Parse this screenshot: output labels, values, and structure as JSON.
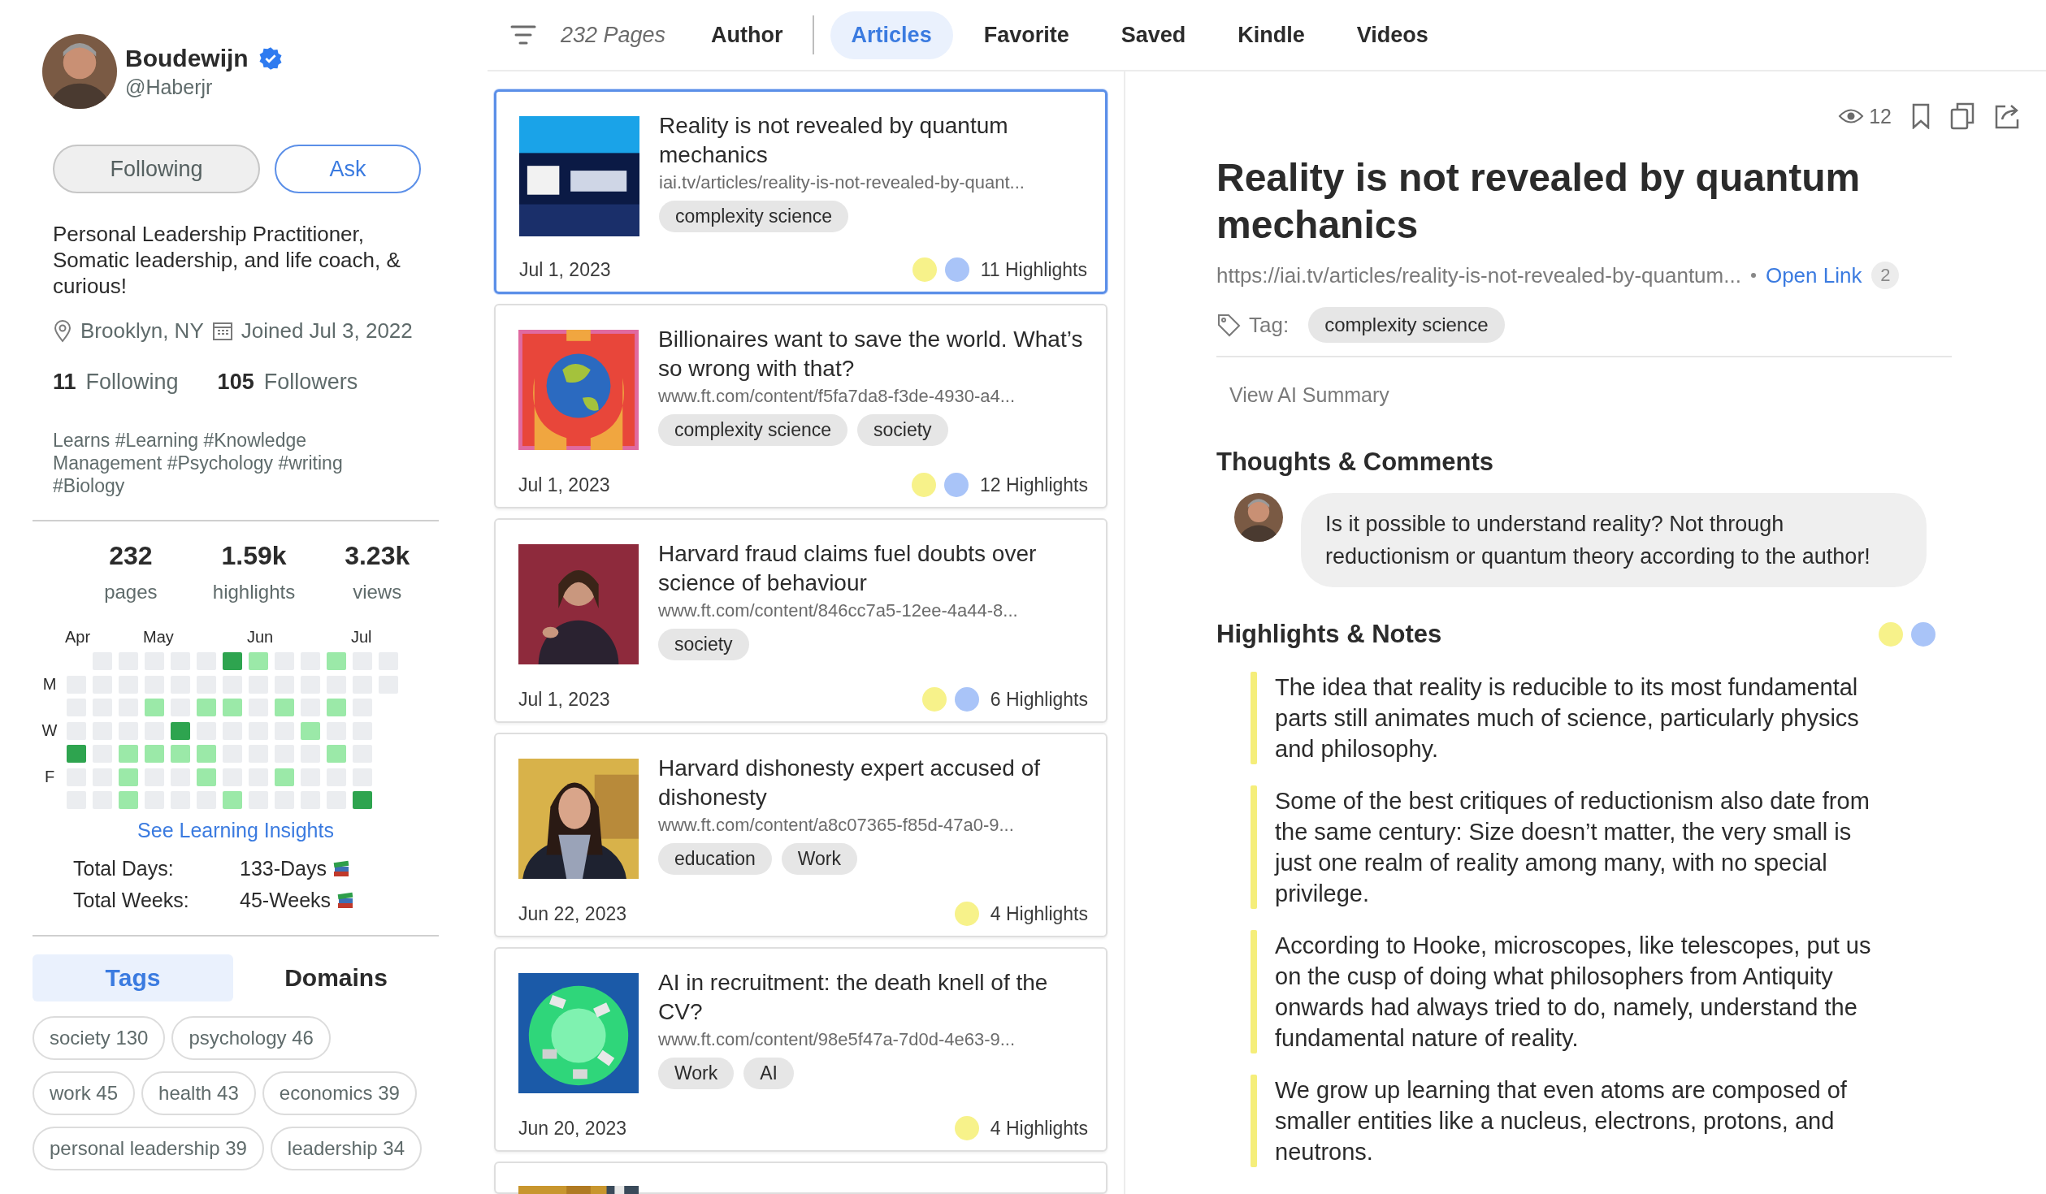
{
  "profile": {
    "name": "Boudewijn",
    "verified": true,
    "handle": "@Haberjr",
    "buttons": [
      {
        "label": "Following",
        "kind": "secondary"
      },
      {
        "label": "Ask",
        "kind": "outline"
      }
    ],
    "bio": "Personal Leadership Practitioner, Somatic leadership, and life coach, & curious!",
    "location": "Brooklyn, NY",
    "joined": "Joined Jul 3, 2022",
    "following_count": "11",
    "following_label": "Following",
    "followers_count": "105",
    "followers_label": "Followers",
    "interests": "Learns #Learning #Knowledge Management #Psychology #writing #Biology",
    "stats": [
      {
        "value": "232",
        "label": "pages"
      },
      {
        "value": "1.59k",
        "label": "highlights"
      },
      {
        "value": "3.23k",
        "label": "views"
      }
    ]
  },
  "activity": {
    "months": [
      "Apr",
      "May",
      "Jun",
      "Jul"
    ],
    "rows": [
      {
        "cells": [
          null,
          {
            "kind": "empty"
          },
          {
            "kind": "empty"
          },
          {
            "kind": "empty"
          },
          {
            "kind": "empty"
          },
          {
            "kind": "empty"
          },
          {
            "kind": "dark"
          },
          {
            "kind": "light"
          },
          {
            "kind": "empty"
          },
          {
            "kind": "empty"
          },
          {
            "kind": "light"
          },
          {
            "kind": "empty"
          },
          {
            "kind": "empty"
          }
        ]
      },
      {
        "label": "M",
        "cells": [
          {
            "kind": "empty"
          },
          {
            "kind": "empty"
          },
          {
            "kind": "empty"
          },
          {
            "kind": "empty"
          },
          {
            "kind": "empty"
          },
          {
            "kind": "empty"
          },
          {
            "kind": "empty"
          },
          {
            "kind": "empty"
          },
          {
            "kind": "empty"
          },
          {
            "kind": "empty"
          },
          {
            "kind": "empty"
          },
          {
            "kind": "empty"
          },
          {
            "kind": "empty"
          }
        ]
      },
      {
        "cells": [
          {
            "kind": "empty"
          },
          {
            "kind": "empty"
          },
          {
            "kind": "empty"
          },
          {
            "kind": "light"
          },
          {
            "kind": "empty"
          },
          {
            "kind": "light"
          },
          {
            "kind": "light"
          },
          {
            "kind": "empty"
          },
          {
            "kind": "light"
          },
          {
            "kind": "empty"
          },
          {
            "kind": "light"
          },
          {
            "kind": "empty"
          }
        ]
      },
      {
        "label": "W",
        "cells": [
          {
            "kind": "empty"
          },
          {
            "kind": "empty"
          },
          {
            "kind": "empty"
          },
          {
            "kind": "empty"
          },
          {
            "kind": "dark"
          },
          {
            "kind": "empty"
          },
          {
            "kind": "empty"
          },
          {
            "kind": "empty"
          },
          {
            "kind": "empty"
          },
          {
            "kind": "light"
          },
          {
            "kind": "empty"
          },
          {
            "kind": "empty"
          }
        ]
      },
      {
        "cells": [
          {
            "kind": "dark"
          },
          {
            "kind": "empty"
          },
          {
            "kind": "light"
          },
          {
            "kind": "light"
          },
          {
            "kind": "light"
          },
          {
            "kind": "light"
          },
          {
            "kind": "empty"
          },
          {
            "kind": "empty"
          },
          {
            "kind": "empty"
          },
          {
            "kind": "empty"
          },
          {
            "kind": "light"
          },
          {
            "kind": "empty"
          }
        ]
      },
      {
        "label": "F",
        "cells": [
          {
            "kind": "empty"
          },
          {
            "kind": "empty"
          },
          {
            "kind": "light"
          },
          {
            "kind": "empty"
          },
          {
            "kind": "empty"
          },
          {
            "kind": "light"
          },
          {
            "kind": "empty"
          },
          {
            "kind": "empty"
          },
          {
            "kind": "light"
          },
          {
            "kind": "empty"
          },
          {
            "kind": "empty"
          },
          {
            "kind": "empty"
          }
        ]
      },
      {
        "cells": [
          {
            "kind": "empty"
          },
          {
            "kind": "empty"
          },
          {
            "kind": "light"
          },
          {
            "kind": "empty"
          },
          {
            "kind": "empty"
          },
          {
            "kind": "empty"
          },
          {
            "kind": "light"
          },
          {
            "kind": "empty"
          },
          {
            "kind": "empty"
          },
          {
            "kind": "empty"
          },
          {
            "kind": "empty"
          },
          {
            "kind": "dark"
          }
        ]
      }
    ],
    "link": "See Learning Insights",
    "totals": [
      {
        "label": "Total Days:",
        "value": "133-Days"
      },
      {
        "label": "Total Weeks:",
        "value": "45-Weeks"
      }
    ]
  },
  "sidebar_tabs": [
    {
      "label": "Tags",
      "selected": true
    },
    {
      "label": "Domains",
      "selected": false
    }
  ],
  "tag_counts": [
    {
      "name": "society",
      "count": "130"
    },
    {
      "name": "psychology",
      "count": "46"
    },
    {
      "name": "work",
      "count": "45"
    },
    {
      "name": "health",
      "count": "43"
    },
    {
      "name": "economics",
      "count": "39"
    },
    {
      "name": "personal leadership",
      "count": "39"
    },
    {
      "name": "leadership",
      "count": "34"
    }
  ],
  "toolbar": {
    "page_count": "232 Pages",
    "tabs": [
      {
        "label": "Author",
        "selected": false
      },
      {
        "label": "Articles",
        "selected": true
      },
      {
        "label": "Favorite",
        "selected": false
      },
      {
        "label": "Saved",
        "selected": false
      },
      {
        "label": "Kindle",
        "selected": false
      },
      {
        "label": "Videos",
        "selected": false
      }
    ]
  },
  "articles": [
    {
      "kind": "full",
      "selected": true,
      "title": "Reality is not revealed by quantum mechanics",
      "url": "iai.tv/articles/reality-is-not-revealed-by-quant...",
      "tags": [
        "complexity science"
      ],
      "date": "Jul 1, 2023",
      "dots": [
        {
          "color": "#f7f28a"
        },
        {
          "color": "#a9c4f8"
        }
      ],
      "highlights": "11 Highlights"
    },
    {
      "kind": "full",
      "selected": false,
      "title": "Billionaires want to save the world. What’s so wrong with that?",
      "url": "www.ft.com/content/f5fa7da8-f3de-4930-a4...",
      "tags": [
        "complexity science",
        "society"
      ],
      "date": "Jul 1, 2023",
      "dots": [
        {
          "color": "#f7f28a"
        },
        {
          "color": "#a9c4f8"
        }
      ],
      "highlights": "12 Highlights"
    },
    {
      "kind": "full",
      "selected": false,
      "title": "Harvard fraud claims fuel doubts over science of behaviour",
      "url": "www.ft.com/content/846cc7a5-12ee-4a44-8...",
      "tags": [
        "society"
      ],
      "date": "Jul 1, 2023",
      "dots": [
        {
          "color": "#f7f28a"
        },
        {
          "color": "#a9c4f8"
        }
      ],
      "highlights": "6 Highlights"
    },
    {
      "kind": "full",
      "selected": false,
      "title": "Harvard dishonesty expert accused of dishonesty",
      "url": "www.ft.com/content/a8c07365-f85d-47a0-9...",
      "tags": [
        "education",
        "Work"
      ],
      "date": "Jun 22, 2023",
      "dots": [
        {
          "color": "#f7f28a"
        }
      ],
      "highlights": "4 Highlights"
    },
    {
      "kind": "full",
      "selected": false,
      "title": "AI in recruitment: the death knell of the CV?",
      "url": "www.ft.com/content/98e5f47a-7d0d-4e63-9...",
      "tags": [
        "Work",
        "AI"
      ],
      "date": "Jun 20, 2023",
      "dots": [
        {
          "color": "#f7f28a"
        }
      ],
      "highlights": "4 Highlights"
    },
    {
      "kind": "cut_off"
    }
  ],
  "detail": {
    "views": "12",
    "title": "Reality is not revealed by quantum mechanics",
    "url": "https://iai.tv/articles/reality-is-not-revealed-by-quantum...",
    "open_link": "Open Link",
    "link_count": "2",
    "tag_label": "Tag:",
    "tags": [
      "complexity science"
    ],
    "summary_button": "View AI Summary",
    "comments_heading": "Thoughts & Comments",
    "comment": "Is it possible to understand reality? Not through reductionism or quantum theory according to the author!",
    "highlights_heading": "Highlights & Notes",
    "highlight_dots": [
      {
        "color": "#f7f28a"
      },
      {
        "color": "#a9c4f8"
      }
    ],
    "notes": [
      {
        "color": "#f5ee7a",
        "text": "The idea that reality is reducible to its most fundamental parts still animates much of science, particularly physics and philosophy."
      },
      {
        "color": "#f5ee7a",
        "text": "Some of the best critiques of reductionism also date from the same century: Size doesn’t matter, the very small is just one realm of reality among many, with no special privilege."
      },
      {
        "color": "#f5ee7a",
        "text": "According to Hooke, microscopes, like telescopes, put us on the cusp of doing what philosophers from Antiquity onwards had always tried to do, namely, understand the fundamental nature of reality."
      },
      {
        "color": "#f5ee7a",
        "text": "We grow up learning that even atoms are composed of smaller entities like a nucleus, electrons, protons, and neutrons."
      }
    ]
  }
}
